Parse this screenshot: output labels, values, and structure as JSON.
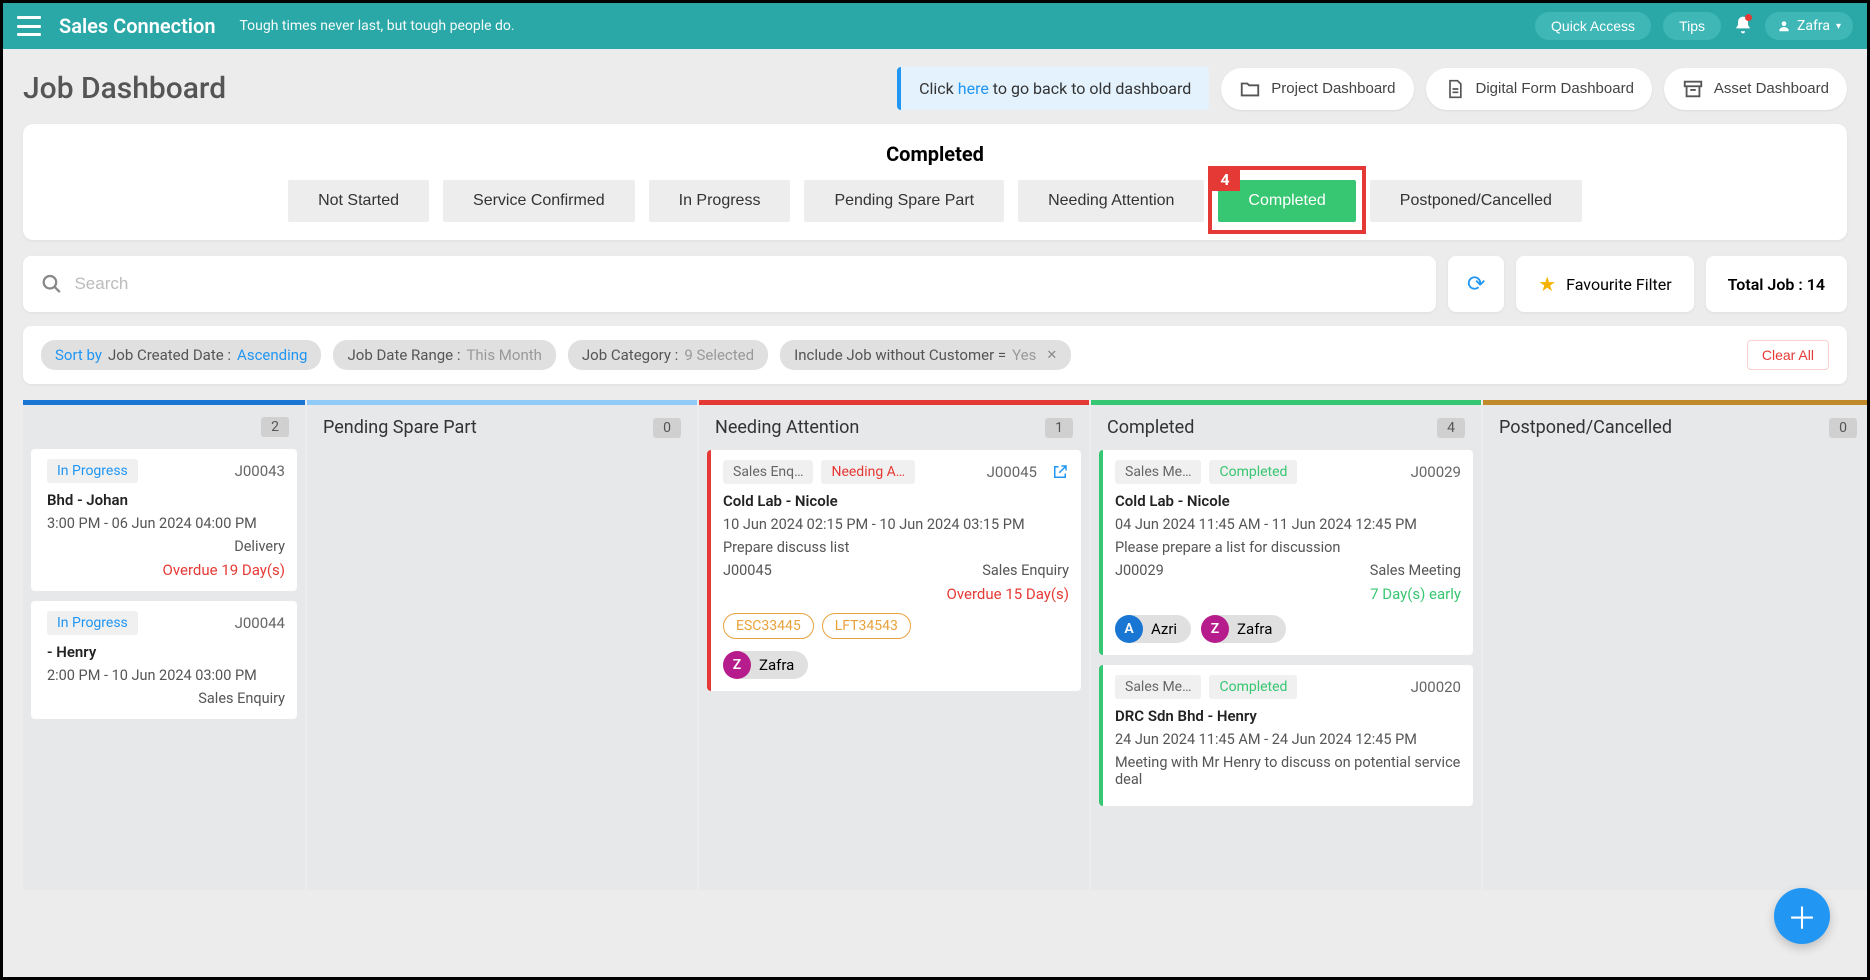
{
  "topbar": {
    "brand": "Sales Connection",
    "tagline": "Tough times never last, but tough people do.",
    "quick_access": "Quick Access",
    "tips": "Tips",
    "user": "Zafra"
  },
  "header": {
    "title": "Job Dashboard",
    "notice_pre": "Click ",
    "notice_link": "here",
    "notice_post": " to go back to old dashboard",
    "project_btn": "Project Dashboard",
    "form_btn": "Digital Form Dashboard",
    "asset_btn": "Asset Dashboard"
  },
  "status_panel": {
    "title": "Completed",
    "highlight_num": "4",
    "tabs": [
      "Not Started",
      "Service Confirmed",
      "In Progress",
      "Pending Spare Part",
      "Needing Attention",
      "Completed",
      "Postponed/Cancelled"
    ],
    "active_index": 5
  },
  "search": {
    "placeholder": "Search",
    "fav_label": "Favourite Filter",
    "total_label": "Total Job : 14"
  },
  "filters": {
    "sort_prefix": "Sort by",
    "sort_field": "Job Created Date :",
    "sort_dir": "Ascending",
    "date_label": "Job Date Range :",
    "date_val": "This Month",
    "cat_label": "Job Category :",
    "cat_val": "9 Selected",
    "inc_label": "Include Job without Customer =",
    "inc_val": "Yes",
    "clear": "Clear All"
  },
  "columns": [
    {
      "title": "",
      "count": "2"
    },
    {
      "title": "Pending Spare Part",
      "count": "0"
    },
    {
      "title": "Needing Attention",
      "count": "1"
    },
    {
      "title": "Completed",
      "count": "4"
    },
    {
      "title": "Postponed/Cancelled",
      "count": "0"
    }
  ],
  "cards": {
    "c0a": {
      "status": "In Progress",
      "id": "J00043",
      "title": "Bhd - Johan",
      "time": "3:00 PM - 06 Jun 2024 04:00 PM",
      "type": "Delivery",
      "overdue": "Overdue 19 Day(s)"
    },
    "c0b": {
      "status": "In Progress",
      "id": "J00044",
      "title": "- Henry",
      "time": "2:00 PM - 10 Jun 2024 03:00 PM",
      "type": "Sales Enquiry"
    },
    "c2a": {
      "cat": "Sales Enq…",
      "status": "Needing A…",
      "id": "J00045",
      "title": "Cold Lab - Nicole",
      "time": "10 Jun 2024 02:15 PM - 10 Jun 2024 03:15 PM",
      "desc": "Prepare discuss list",
      "id2": "J00045",
      "type": "Sales Enquiry",
      "overdue": "Overdue 15 Day(s)",
      "assets": [
        "ESC33445",
        "LFT34543"
      ],
      "assignee": "Zafra"
    },
    "c3a": {
      "cat": "Sales Me…",
      "status": "Completed",
      "id": "J00029",
      "title": "Cold Lab - Nicole",
      "time": "04 Jun 2024 11:45 AM - 11 Jun 2024 12:45 PM",
      "desc": "Please prepare a list for discussion",
      "id2": "J00029",
      "type": "Sales Meeting",
      "early": "7 Day(s) early",
      "a1": "Azri",
      "a2": "Zafra"
    },
    "c3b": {
      "cat": "Sales Me…",
      "status": "Completed",
      "id": "J00020",
      "title": "DRC Sdn Bhd - Henry",
      "time": "24 Jun 2024 11:45 AM - 24 Jun 2024 12:45 PM",
      "desc": "Meeting with Mr Henry to discuss on potential service deal"
    }
  }
}
